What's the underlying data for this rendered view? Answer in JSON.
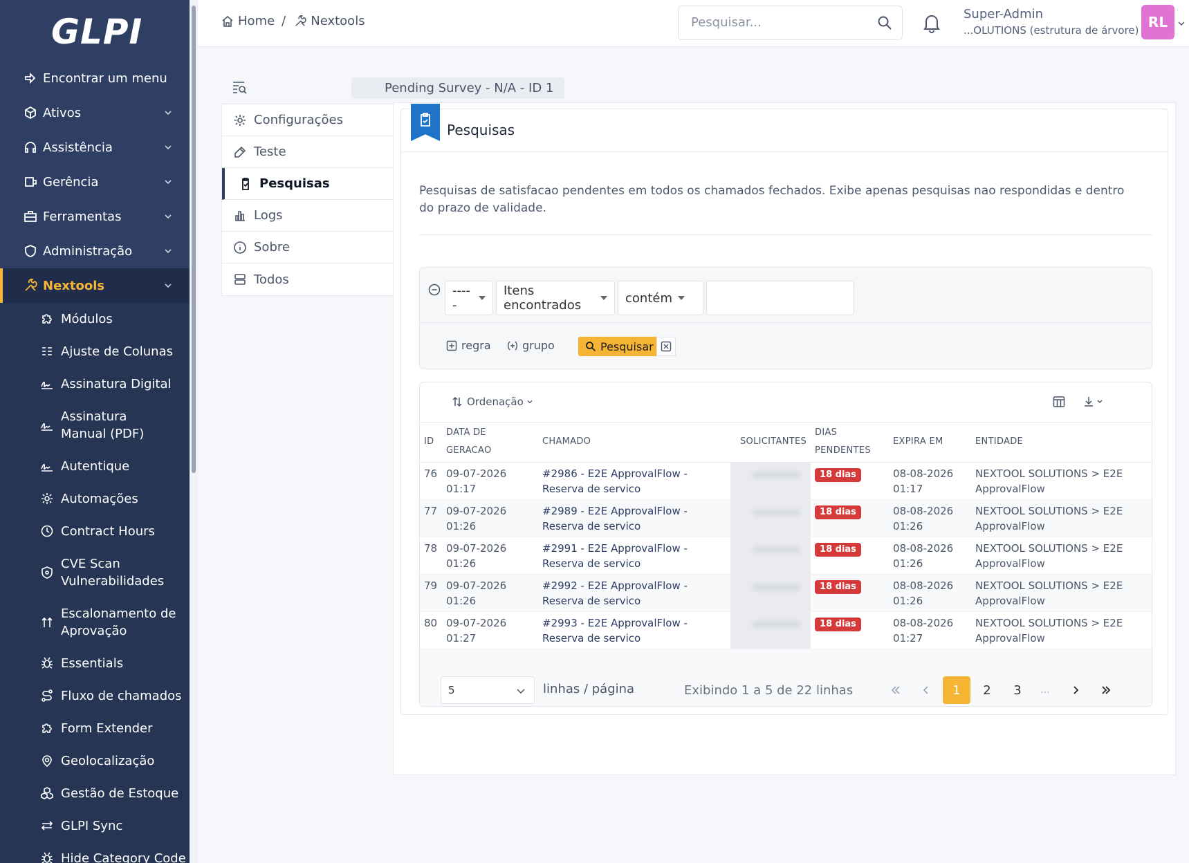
{
  "app": {
    "logo": "GLPI"
  },
  "sidebar": {
    "items": [
      {
        "label": "Encontrar um menu",
        "icon": "arrow-right-icon"
      },
      {
        "label": "Ativos",
        "icon": "package-icon"
      },
      {
        "label": "Assistência",
        "icon": "headset-icon"
      },
      {
        "label": "Gerência",
        "icon": "wallet-icon"
      },
      {
        "label": "Ferramentas",
        "icon": "briefcase-icon"
      },
      {
        "label": "Administração",
        "icon": "shield-icon"
      },
      {
        "label": "Nextools",
        "icon": "tools-icon",
        "active": true
      }
    ],
    "sub_items": [
      {
        "label": "Módulos",
        "icon": "puzzle-icon"
      },
      {
        "label": "Ajuste de Colunas",
        "icon": "columns-icon"
      },
      {
        "label": "Assinatura Digital",
        "icon": "signature-icon"
      },
      {
        "label": "Assinatura Manual (PDF)",
        "icon": "signature-icon"
      },
      {
        "label": "Autentique",
        "icon": "signature-icon"
      },
      {
        "label": "Automações",
        "icon": "gear-icon"
      },
      {
        "label": "Contract Hours",
        "icon": "clock-icon"
      },
      {
        "label": "CVE Scan Vulnerabilidades",
        "icon": "shield-icon"
      },
      {
        "label": "Escalonamento de Aprovação",
        "icon": "arrows-up-icon"
      },
      {
        "label": "Essentials",
        "icon": "bug-icon"
      },
      {
        "label": "Fluxo de chamados",
        "icon": "route-icon"
      },
      {
        "label": "Form Extender",
        "icon": "puzzle-icon"
      },
      {
        "label": "Geolocalização",
        "icon": "map-pin-icon"
      },
      {
        "label": "Gestão de Estoque",
        "icon": "boxes-icon"
      },
      {
        "label": "GLPI Sync",
        "icon": "sync-icon"
      },
      {
        "label": "Hide Category Code",
        "icon": "bug-icon"
      }
    ]
  },
  "header": {
    "breadcrumb": {
      "home": "Home",
      "sep": "/",
      "current": "Nextools"
    },
    "search_placeholder": "Pesquisar...",
    "user_name": "Super-Admin",
    "user_entity": "...OLUTIONS (estrutura de árvore)",
    "avatar": "RL"
  },
  "record": {
    "title": "Pending Survey -  N/A - ID 1"
  },
  "tabs": [
    {
      "label": "Configurações",
      "icon": "gear-icon"
    },
    {
      "label": "Teste",
      "icon": "flask-icon"
    },
    {
      "label": "Pesquisas",
      "icon": "clipboard-check-icon",
      "active": true
    },
    {
      "label": "Logs",
      "icon": "chart-bar-icon"
    },
    {
      "label": "Sobre",
      "icon": "info-icon"
    },
    {
      "label": "Todos",
      "icon": "layers-icon"
    }
  ],
  "card": {
    "title": "Pesquisas",
    "description": "Pesquisas de satisfacao pendentes em todos os chamados fechados. Exibe apenas pesquisas nao respondidas e dentro do prazo de validade."
  },
  "criteria": {
    "link": "-----",
    "field": "Itens encontrados",
    "operator": "contém",
    "value": "",
    "add_rule": "regra",
    "add_group": "grupo",
    "search_button": "Pesquisar"
  },
  "table": {
    "sort_label": "Ordenação",
    "columns": [
      "ID",
      "DATA DE GERACAO",
      "CHAMADO",
      "SOLICITANTES",
      "DIAS PENDENTES",
      "EXPIRA EM",
      "ENTIDADE"
    ],
    "rows": [
      {
        "id": "76",
        "date": "09-07-2026 01:17",
        "ticket": "#2986 - E2E ApprovalFlow - Reserva de servico",
        "days": "18 dias",
        "expires": "08-08-2026 01:17",
        "entity": "NEXTOOL SOLUTIONS > E2E ApprovalFlow"
      },
      {
        "id": "77",
        "date": "09-07-2026 01:26",
        "ticket": "#2989 - E2E ApprovalFlow - Reserva de servico",
        "days": "18 dias",
        "expires": "08-08-2026 01:26",
        "entity": "NEXTOOL SOLUTIONS > E2E ApprovalFlow"
      },
      {
        "id": "78",
        "date": "09-07-2026 01:26",
        "ticket": "#2991 - E2E ApprovalFlow - Reserva de servico",
        "days": "18 dias",
        "expires": "08-08-2026 01:26",
        "entity": "NEXTOOL SOLUTIONS > E2E ApprovalFlow"
      },
      {
        "id": "79",
        "date": "09-07-2026 01:26",
        "ticket": "#2992 - E2E ApprovalFlow - Reserva de servico",
        "days": "18 dias",
        "expires": "08-08-2026 01:26",
        "entity": "NEXTOOL SOLUTIONS > E2E ApprovalFlow"
      },
      {
        "id": "80",
        "date": "09-07-2026 01:27",
        "ticket": "#2993 - E2E ApprovalFlow - Reserva de servico",
        "days": "18 dias",
        "expires": "08-08-2026 01:27",
        "entity": "NEXTOOL SOLUTIONS > E2E ApprovalFlow"
      }
    ]
  },
  "pagination": {
    "per_page": "5",
    "per_page_label": "linhas / página",
    "info": "Exibindo 1 a 5 de 22 linhas",
    "pages": [
      "1",
      "2",
      "3",
      "..."
    ],
    "current": "1"
  },
  "colors": {
    "sidebar": "#2f3f64",
    "accent": "#f5b434",
    "badge": "#d63939",
    "ribbon": "#1f73c9",
    "avatar": "#e073d4"
  }
}
